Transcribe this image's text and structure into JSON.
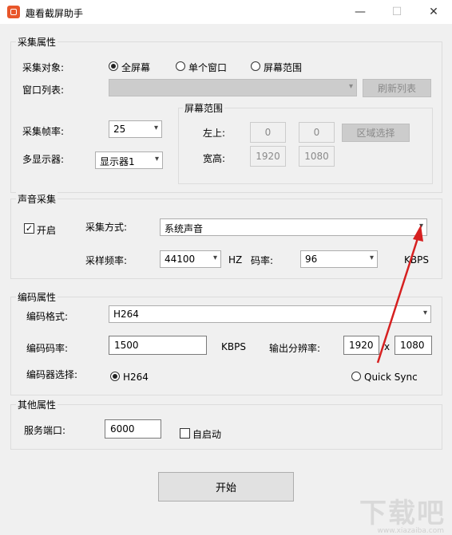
{
  "window": {
    "title": "趣看截屏助手",
    "minimize": "—",
    "maximize": "☐",
    "close": "✕"
  },
  "capture": {
    "group_title": "采集属性",
    "target_label": "采集对象:",
    "targets": [
      "全屏幕",
      "单个窗口",
      "屏幕范围"
    ],
    "selected_target": "全屏幕",
    "window_list_label": "窗口列表:",
    "refresh_button": "刷新列表",
    "fps_label": "采集帧率:",
    "fps_value": "25",
    "monitor_label": "多显示器:",
    "monitor_value": "显示器1",
    "region": {
      "group_title": "屏幕范围",
      "top_left_label": "左上:",
      "x": "0",
      "y": "0",
      "select_button": "区域选择",
      "size_label": "宽高:",
      "width": "1920",
      "height": "1080"
    }
  },
  "audio": {
    "group_title": "声音采集",
    "enabled_label": "开启",
    "enabled": true,
    "mode_label": "采集方式:",
    "mode_value": "系统声音",
    "sample_rate_label": "采样频率:",
    "sample_rate_value": "44100",
    "hz": "HZ",
    "bitrate_label": "码率:",
    "bitrate_value": "96",
    "kbps": "KBPS"
  },
  "encoding": {
    "group_title": "编码属性",
    "format_label": "编码格式:",
    "format_value": "H264",
    "bitrate_label": "编码码率:",
    "bitrate_value": "1500",
    "kbps": "KBPS",
    "resolution_label": "输出分辨率:",
    "res_w": "1920",
    "res_x": "x",
    "res_h": "1080",
    "encoder_label": "编码器选择:",
    "encoder_h264": "H264",
    "encoder_qs": "Quick Sync",
    "selected_encoder": "H264"
  },
  "other": {
    "group_title": "其他属性",
    "port_label": "服务端口:",
    "port_value": "6000",
    "autostart_label": "自启动",
    "autostart": false
  },
  "start_button": "开始",
  "watermark": {
    "main": "下载吧",
    "sub": "www.xiazaiba.com"
  },
  "colors": {
    "annotation_arrow": "#d62020",
    "window_bg": "#f0f0f0"
  }
}
